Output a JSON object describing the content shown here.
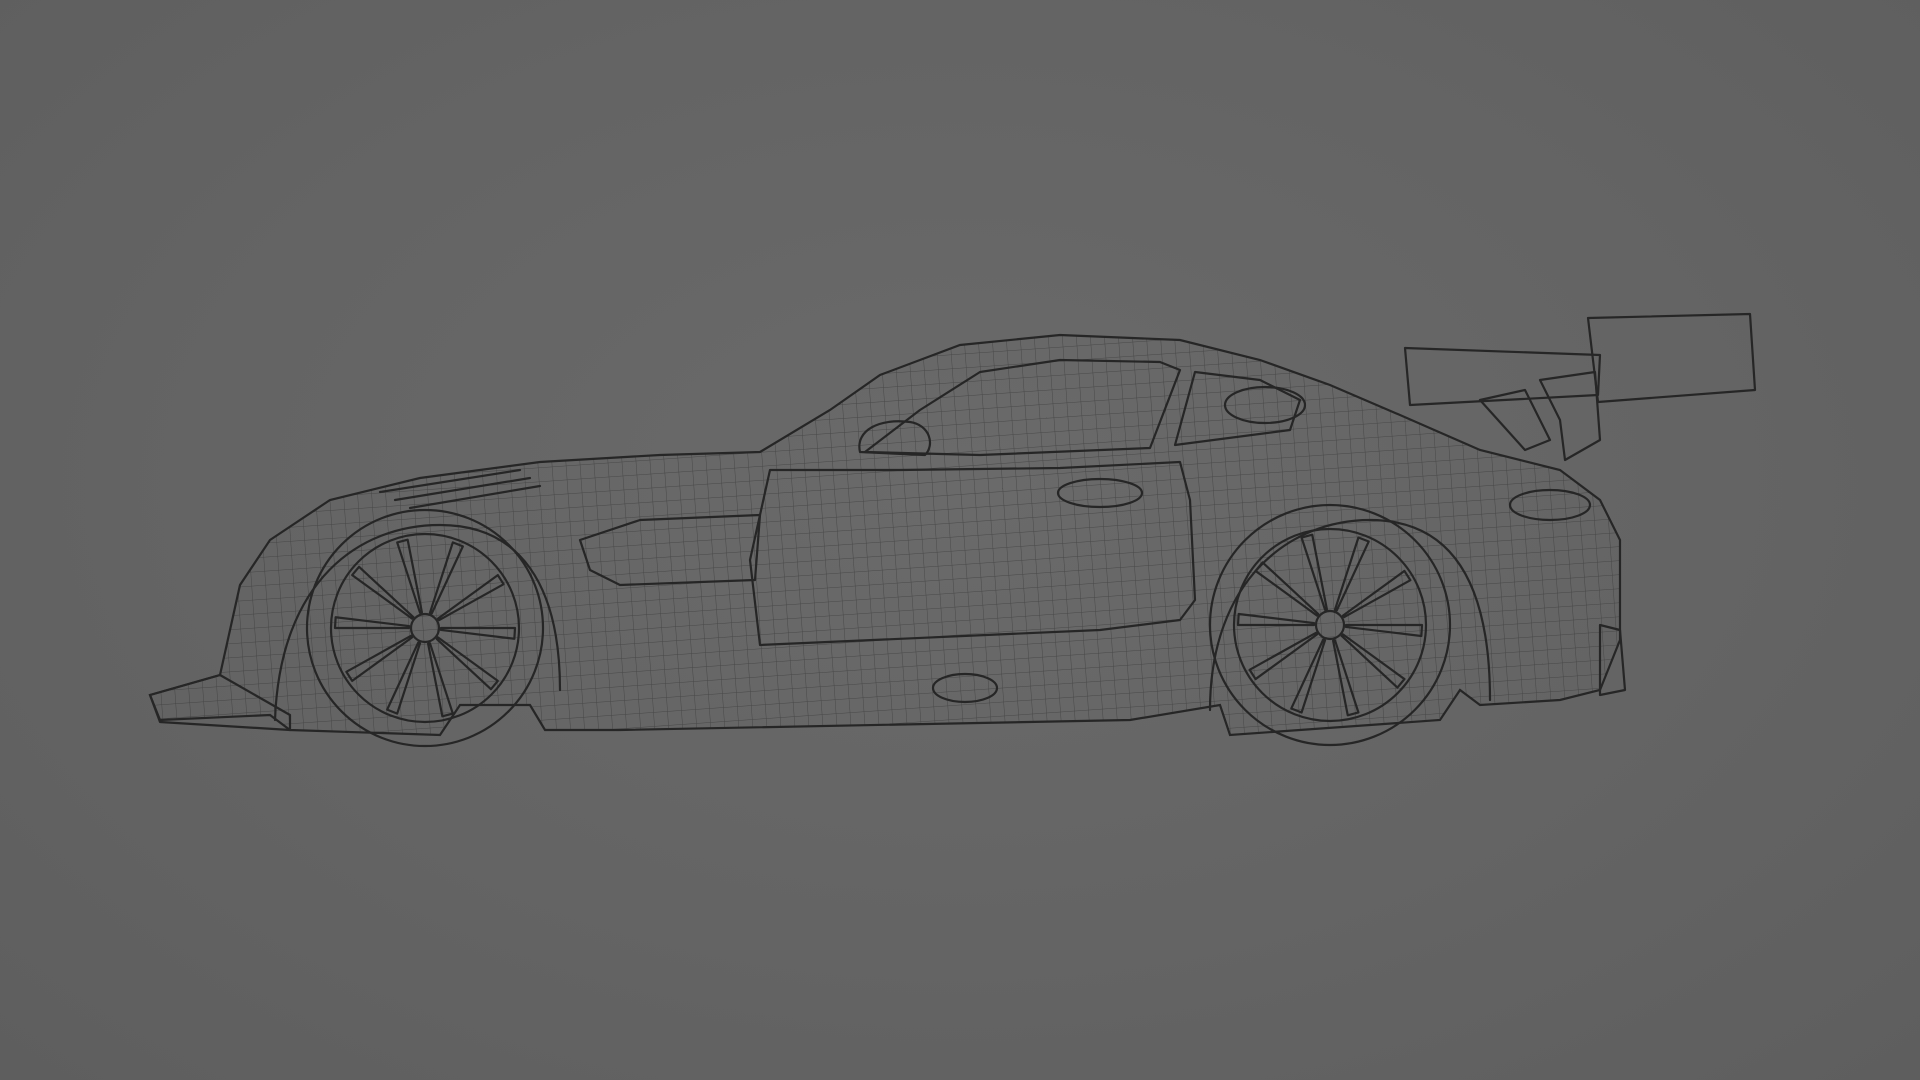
{
  "scene": {
    "background_color": "#656565",
    "wire_color": "#262626",
    "subject": "race-car-wireframe"
  }
}
